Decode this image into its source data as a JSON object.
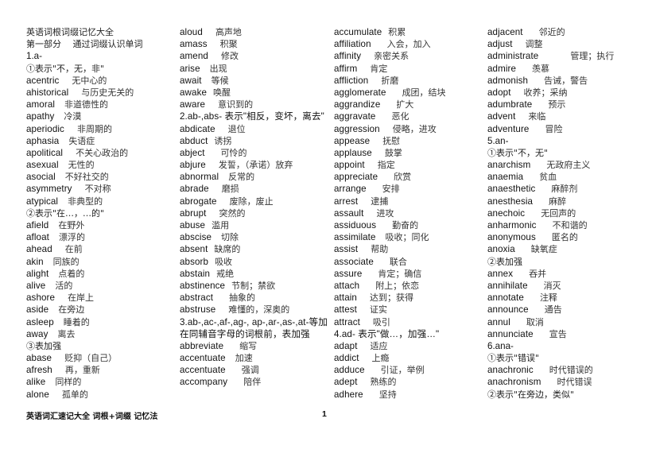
{
  "document": {
    "title": "英语词根词缀记忆大全",
    "part": "第一部分　通过词缀认识单词"
  },
  "columns": [
    [
      {
        "type": "head",
        "text": "英语词根词缀记忆大全"
      },
      {
        "type": "head",
        "text": "第一部分　 通过词缀认识单词"
      },
      {
        "type": "sec",
        "text": "1.a-"
      },
      {
        "type": "head",
        "text": "①表示\"不，无，非\""
      },
      {
        "type": "entry",
        "en": "acentric",
        "zh": "无中心的",
        "gap": 3
      },
      {
        "type": "entry",
        "en": "ahistorical",
        "zh": "与历史无关的",
        "gap": 3
      },
      {
        "type": "entry",
        "en": "amoral",
        "zh": "非道德性的",
        "gap": 2
      },
      {
        "type": "entry",
        "en": "apathy",
        "zh": "冷漠",
        "gap": 2
      },
      {
        "type": "entry",
        "en": "aperiodic",
        "zh": "非周期的",
        "gap": 3
      },
      {
        "type": "entry",
        "en": "aphasia",
        "zh": "失语症",
        "gap": 2
      },
      {
        "type": "entry",
        "en": "apolitical",
        "zh": "不关心政治的",
        "gap": 3
      },
      {
        "type": "entry",
        "en": "asexual",
        "zh": "无性的",
        "gap": 2
      },
      {
        "type": "entry",
        "en": "asocial",
        "zh": "不好社交的",
        "gap": 2
      },
      {
        "type": "entry",
        "en": "asymmetry",
        "zh": "不对称",
        "gap": 3
      },
      {
        "type": "entry",
        "en": "atypical",
        "zh": "非典型的",
        "gap": 2
      },
      {
        "type": "head",
        "text": "②表示\"在…，…的\""
      },
      {
        "type": "entry",
        "en": "afield",
        "zh": "在野外",
        "gap": 2
      },
      {
        "type": "entry",
        "en": "afloat",
        "zh": "漂浮的",
        "gap": 2
      },
      {
        "type": "entry",
        "en": "ahead",
        "zh": "在前",
        "gap": 3
      },
      {
        "type": "entry",
        "en": "akin",
        "zh": "同族的",
        "gap": 2
      },
      {
        "type": "entry",
        "en": "alight",
        "zh": "点着的",
        "gap": 2
      },
      {
        "type": "entry",
        "en": "alive",
        "zh": "活的",
        "gap": 2
      },
      {
        "type": "entry",
        "en": "ashore",
        "zh": "在岸上",
        "gap": 3
      },
      {
        "type": "entry",
        "en": "aside",
        "zh": "在旁边",
        "gap": 2
      },
      {
        "type": "entry",
        "en": "asleep",
        "zh": "睡着的",
        "gap": 2
      },
      {
        "type": "entry",
        "en": "away",
        "zh": "离去",
        "gap": 2
      },
      {
        "type": "head",
        "text": "③表加强"
      },
      {
        "type": "entry",
        "en": "abase",
        "zh": "贬抑（自己）",
        "gap": 3
      },
      {
        "type": "entry",
        "en": "afresh",
        "zh": "再，重新",
        "gap": 3
      },
      {
        "type": "entry",
        "en": "alike",
        "zh": "同样的",
        "gap": 2
      },
      {
        "type": "entry",
        "en": "alone",
        "zh": "孤单的",
        "gap": 3
      }
    ],
    [
      {
        "type": "entry",
        "en": "aloud",
        "zh": "高声地",
        "gap": 3
      },
      {
        "type": "entry",
        "en": "amass",
        "zh": "积聚",
        "gap": 3
      },
      {
        "type": "entry",
        "en": "amend",
        "zh": "修改",
        "gap": 3
      },
      {
        "type": "entry",
        "en": "arise",
        "zh": "出现",
        "gap": 2
      },
      {
        "type": "entry",
        "en": "await",
        "zh": "等候",
        "gap": 2
      },
      {
        "type": "entry",
        "en": "awake",
        "zh": "唤醒",
        "gap": 1
      },
      {
        "type": "entry",
        "en": "aware",
        "zh": "意识到的",
        "gap": 3
      },
      {
        "type": "wrap",
        "text": "2.ab-,abs- 表示\"相反，变坏，离去\""
      },
      {
        "type": "entry",
        "en": "abdicate",
        "zh": "退位",
        "gap": 3
      },
      {
        "type": "entry",
        "en": "abduct",
        "zh": "诱拐",
        "gap": 1
      },
      {
        "type": "entry",
        "en": "abject",
        "zh": "可怜的",
        "gap": 4
      },
      {
        "type": "entry",
        "en": "abjure",
        "zh": "发誓，（承诺）放弃",
        "gap": 3
      },
      {
        "type": "entry",
        "en": "abnormal",
        "zh": "反常的",
        "gap": 2
      },
      {
        "type": "entry",
        "en": "abrade",
        "zh": "磨损",
        "gap": 3
      },
      {
        "type": "entry",
        "en": "abrogate",
        "zh": "废除，废止",
        "gap": 3
      },
      {
        "type": "entry",
        "en": "abrupt",
        "zh": "突然的",
        "gap": 3
      },
      {
        "type": "entry",
        "en": "abuse",
        "zh": "滥用",
        "gap": 1
      },
      {
        "type": "entry",
        "en": "abscise",
        "zh": "切除",
        "gap": 0
      },
      {
        "type": "entry",
        "en": "absent",
        "zh": "缺席的",
        "gap": 1
      },
      {
        "type": "entry",
        "en": "absorb",
        "zh": "吸收",
        "gap": 1
      },
      {
        "type": "entry",
        "en": "abstain",
        "zh": "戒绝",
        "gap": 1
      },
      {
        "type": "entry",
        "en": "abstinence",
        "zh": "节制；禁欲",
        "gap": 1
      },
      {
        "type": "entry",
        "en": "abstract",
        "zh": "抽象的",
        "gap": 4
      },
      {
        "type": "entry",
        "en": "abstruse",
        "zh": "难懂的，深奥的",
        "gap": 3
      },
      {
        "type": "wrap",
        "text": "3.ab-,ac-,af-,ag-, ap-,ar-,as-,at-等加在同辅音字母的词根前，表加强"
      },
      {
        "type": "entry",
        "en": "abbreviate",
        "zh": "缩写",
        "gap": 4
      },
      {
        "type": "entry",
        "en": "accentuate",
        "zh": "加速",
        "gap": 0
      },
      {
        "type": "entry",
        "en": "accentuate",
        "zh": "强调",
        "gap": 4
      },
      {
        "type": "entry",
        "en": "accompany",
        "zh": "陪伴",
        "gap": 4
      }
    ],
    [
      {
        "type": "entry",
        "en": "accumulate",
        "zh": "积累",
        "gap": 1
      },
      {
        "type": "entry",
        "en": "affiliation",
        "zh": "入会，加入",
        "gap": 4
      },
      {
        "type": "entry",
        "en": "affinity",
        "zh": "亲密关系",
        "gap": 3
      },
      {
        "type": "entry",
        "en": "affirm",
        "zh": "肯定",
        "gap": 3
      },
      {
        "type": "entry",
        "en": "affliction",
        "zh": "折磨",
        "gap": 3
      },
      {
        "type": "entry",
        "en": "agglomerate",
        "zh": "成团，结块",
        "gap": 4
      },
      {
        "type": "entry",
        "en": "aggrandize",
        "zh": "扩大",
        "gap": 4
      },
      {
        "type": "entry",
        "en": "aggravate",
        "zh": "恶化",
        "gap": 4
      },
      {
        "type": "entry",
        "en": "aggression",
        "zh": "侵略，进攻",
        "gap": 3
      },
      {
        "type": "entry",
        "en": "appease",
        "zh": "抚慰",
        "gap": 3
      },
      {
        "type": "entry",
        "en": "applause",
        "zh": "鼓掌",
        "gap": 3
      },
      {
        "type": "entry",
        "en": "appoint",
        "zh": "指定",
        "gap": 3
      },
      {
        "type": "entry",
        "en": "appreciate",
        "zh": "欣赏",
        "gap": 4
      },
      {
        "type": "entry",
        "en": "arrange",
        "zh": "安排",
        "gap": 4
      },
      {
        "type": "entry",
        "en": "arrest",
        "zh": "逮捕",
        "gap": 3
      },
      {
        "type": "entry",
        "en": "assault",
        "zh": "进攻",
        "gap": 3
      },
      {
        "type": "entry",
        "en": "assiduous",
        "zh": "勤奋的",
        "gap": 4
      },
      {
        "type": "entry",
        "en": "assimilate",
        "zh": "吸收；同化",
        "gap": 2
      },
      {
        "type": "entry",
        "en": "assist",
        "zh": "帮助",
        "gap": 3
      },
      {
        "type": "entry",
        "en": "associate",
        "zh": "联合",
        "gap": 4
      },
      {
        "type": "entry",
        "en": "assure",
        "zh": "肯定；确信",
        "gap": 4
      },
      {
        "type": "entry",
        "en": "attach",
        "zh": "附上；依恋",
        "gap": 4
      },
      {
        "type": "entry",
        "en": "attain",
        "zh": "达到；获得",
        "gap": 3
      },
      {
        "type": "entry",
        "en": "attest",
        "zh": "证实",
        "gap": 3
      },
      {
        "type": "entry",
        "en": "attract",
        "zh": "吸引",
        "gap": 3
      },
      {
        "type": "head2",
        "text": "4.ad- 表示\"做…，加强…\""
      },
      {
        "type": "entry",
        "en": "adapt",
        "zh": "适应",
        "gap": 3
      },
      {
        "type": "entry",
        "en": "addict",
        "zh": "上瘾",
        "gap": 3
      },
      {
        "type": "entry",
        "en": "adduce",
        "zh": "引证，举例",
        "gap": 4
      },
      {
        "type": "entry",
        "en": "adept",
        "zh": "熟练的",
        "gap": 3
      },
      {
        "type": "entry",
        "en": "adhere",
        "zh": "坚持",
        "gap": 4
      }
    ],
    [
      {
        "type": "entry",
        "en": "adjacent",
        "zh": "邻近的",
        "gap": 4
      },
      {
        "type": "entry",
        "en": "adjust",
        "zh": "调整",
        "gap": 3
      },
      {
        "type": "entry",
        "en": "administrate",
        "zh": "管理；执行",
        "gap": 9
      },
      {
        "type": "entry",
        "en": "admire",
        "zh": "羡慕",
        "gap": 4
      },
      {
        "type": "entry",
        "en": "admonish",
        "zh": "告诫，警告",
        "gap": 4
      },
      {
        "type": "entry",
        "en": "adopt",
        "zh": "收养；采纳",
        "gap": 3
      },
      {
        "type": "entry",
        "en": "adumbrate",
        "zh": "预示",
        "gap": 4
      },
      {
        "type": "entry",
        "en": "advent",
        "zh": "来临",
        "gap": 3
      },
      {
        "type": "entry",
        "en": "adventure",
        "zh": "冒险",
        "gap": 4
      },
      {
        "type": "sec",
        "text": "5.an-"
      },
      {
        "type": "head",
        "text": "①表示\"不，无\""
      },
      {
        "type": "entry",
        "en": "anarchism",
        "zh": "无政府主义",
        "gap": 4
      },
      {
        "type": "entry",
        "en": "anaemia",
        "zh": "贫血",
        "gap": 4
      },
      {
        "type": "entry",
        "en": "anaesthetic",
        "zh": "麻醉剂",
        "gap": 4
      },
      {
        "type": "entry",
        "en": "anesthesia",
        "zh": "麻醉",
        "gap": 4
      },
      {
        "type": "entry",
        "en": "anechoic",
        "zh": "无回声的",
        "gap": 4
      },
      {
        "type": "entry",
        "en": "anharmonic",
        "zh": "不和谐的",
        "gap": 4
      },
      {
        "type": "entry",
        "en": "anonymous",
        "zh": "匿名的",
        "gap": 4
      },
      {
        "type": "entry",
        "en": "anoxia",
        "zh": "缺氧症",
        "gap": 4
      },
      {
        "type": "head",
        "text": "②表加强"
      },
      {
        "type": "entry",
        "en": "annex",
        "zh": "吞并",
        "gap": 4
      },
      {
        "type": "entry",
        "en": "annihilate",
        "zh": "消灭",
        "gap": 4
      },
      {
        "type": "entry",
        "en": "annotate",
        "zh": "注释",
        "gap": 4
      },
      {
        "type": "entry",
        "en": "announce",
        "zh": "通告",
        "gap": 4
      },
      {
        "type": "entry",
        "en": "annul",
        "zh": "取消",
        "gap": 4
      },
      {
        "type": "entry",
        "en": "annunciate",
        "zh": "宣告",
        "gap": 4
      },
      {
        "type": "sec",
        "text": "6.ana-"
      },
      {
        "type": "head",
        "text": "①表示\"错误\""
      },
      {
        "type": "entry",
        "en": "anachronic",
        "zh": "时代错误的",
        "gap": 4
      },
      {
        "type": "entry",
        "en": "anachronism",
        "zh": "时代错误",
        "gap": 4
      },
      {
        "type": "head",
        "text": "②表示\"在旁边，类似\""
      }
    ]
  ],
  "footer": {
    "title": "英语词汇速记大全  词根+词缀  记忆法",
    "page_number": "1"
  }
}
